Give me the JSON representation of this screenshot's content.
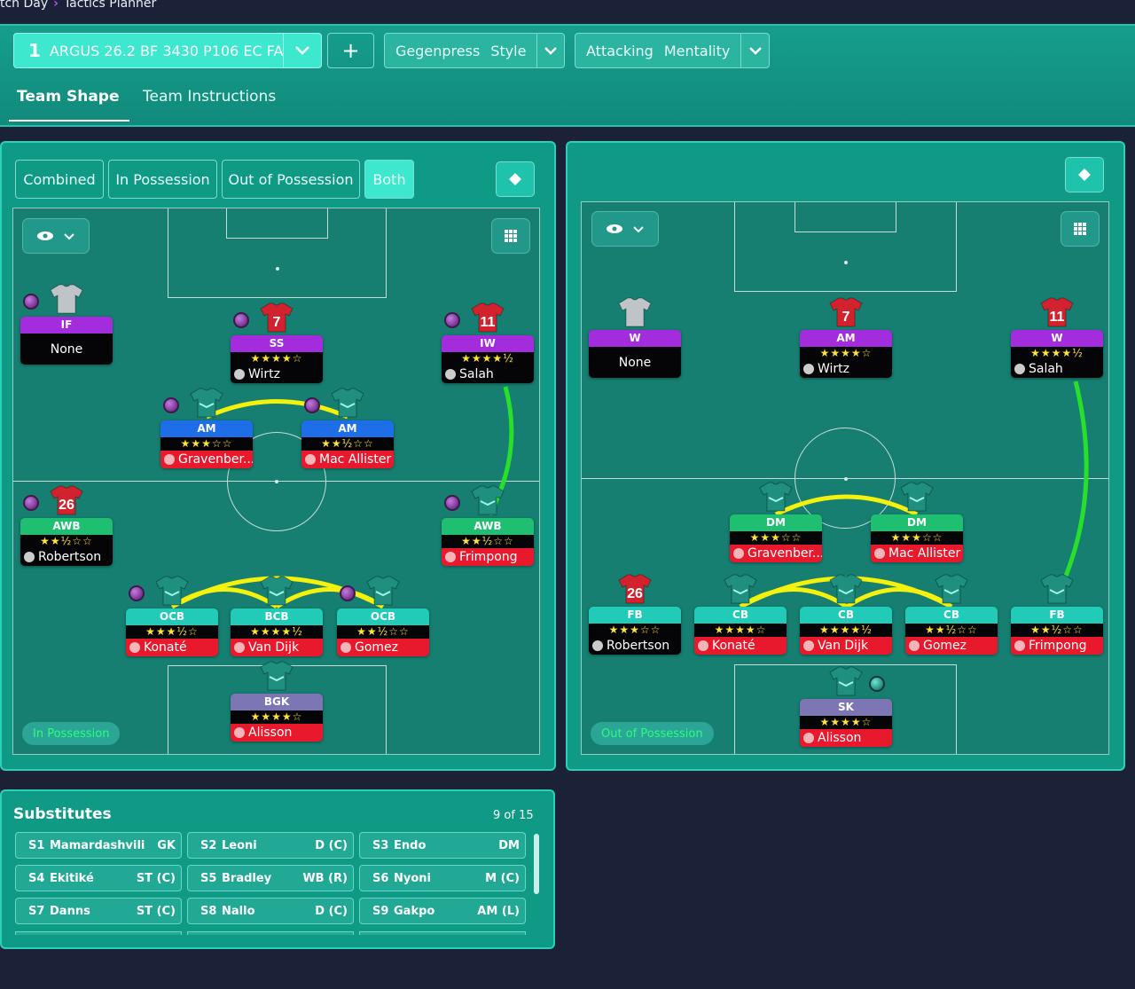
{
  "breadcrumb": {
    "parent": "tch Day",
    "current": "Tactics Planner"
  },
  "tactic": {
    "number": "1",
    "name": "ARGUS 26.2 BF 3430 P106 EC FA",
    "add_label": "+"
  },
  "style": {
    "value": "Gegenpress",
    "label": "Style"
  },
  "mentality": {
    "value": "Attacking",
    "label": "Mentality"
  },
  "tabs": {
    "team_shape": "Team Shape",
    "team_instructions": "Team Instructions"
  },
  "modes": {
    "combined": "Combined",
    "in_possession": "In Possession",
    "out_of_possession": "Out of Possession",
    "both": "Both"
  },
  "colors": {
    "accent": "#3de8cf",
    "panel": "#0f9a86",
    "pitch": "#167f71",
    "attack_role": "#a32cdc",
    "mid_role": "#1e6ee8",
    "wing_role": "#1fbf72",
    "def_role": "#22cbb8",
    "gk_role": "#7c76b4",
    "red": "#e8192c"
  },
  "left_pitch": {
    "label": "In Possession",
    "players": [
      {
        "role": "IF",
        "stars": "",
        "name": "None",
        "number": ""
      },
      {
        "role": "SS",
        "stars": "★★★★☆",
        "name": "Wirtz",
        "number": "7"
      },
      {
        "role": "IW",
        "stars": "★★★★½",
        "name": "Salah",
        "number": "11"
      },
      {
        "role": "AM",
        "stars": "★★★☆☆",
        "name": "Gravenber...",
        "number": ""
      },
      {
        "role": "AM",
        "stars": "★★½☆☆",
        "name": "Mac Allister",
        "number": ""
      },
      {
        "role": "AWB",
        "stars": "★★½☆☆",
        "name": "Robertson",
        "number": "26"
      },
      {
        "role": "AWB",
        "stars": "★★½☆☆",
        "name": "Frimpong",
        "number": ""
      },
      {
        "role": "OCB",
        "stars": "★★★½☆",
        "name": "Konaté",
        "number": ""
      },
      {
        "role": "BCB",
        "stars": "★★★★½",
        "name": "Van Dijk",
        "number": ""
      },
      {
        "role": "OCB",
        "stars": "★★½☆☆",
        "name": "Gomez",
        "number": ""
      },
      {
        "role": "BGK",
        "stars": "★★★★☆",
        "name": "Alisson",
        "number": ""
      }
    ]
  },
  "right_pitch": {
    "label": "Out of Possession",
    "players": [
      {
        "role": "W",
        "stars": "",
        "name": "None",
        "number": ""
      },
      {
        "role": "AM",
        "stars": "★★★★☆",
        "name": "Wirtz",
        "number": "7"
      },
      {
        "role": "W",
        "stars": "★★★★½",
        "name": "Salah",
        "number": "11"
      },
      {
        "role": "DM",
        "stars": "★★★☆☆",
        "name": "Gravenber...",
        "number": ""
      },
      {
        "role": "DM",
        "stars": "★★★☆☆",
        "name": "Mac Allister",
        "number": ""
      },
      {
        "role": "FB",
        "stars": "★★★☆☆",
        "name": "Robertson",
        "number": "26"
      },
      {
        "role": "CB",
        "stars": "★★★★☆",
        "name": "Konaté",
        "number": ""
      },
      {
        "role": "CB",
        "stars": "★★★★½",
        "name": "Van Dijk",
        "number": ""
      },
      {
        "role": "CB",
        "stars": "★★½☆☆",
        "name": "Gomez",
        "number": ""
      },
      {
        "role": "FB",
        "stars": "★★½☆☆",
        "name": "Frimpong",
        "number": ""
      },
      {
        "role": "SK",
        "stars": "★★★★☆",
        "name": "Alisson",
        "number": ""
      }
    ]
  },
  "substitutes": {
    "title": "Substitutes",
    "count": "9 of 15",
    "items": [
      {
        "slot": "S1",
        "name": "Mamardashvili",
        "pos": "GK"
      },
      {
        "slot": "S2",
        "name": "Leoni",
        "pos": "D (C)"
      },
      {
        "slot": "S3",
        "name": "Endo",
        "pos": "DM"
      },
      {
        "slot": "S4",
        "name": "Ekitiké",
        "pos": "ST (C)"
      },
      {
        "slot": "S5",
        "name": "Bradley",
        "pos": "WB (R)"
      },
      {
        "slot": "S6",
        "name": "Nyoni",
        "pos": "M (C)"
      },
      {
        "slot": "S7",
        "name": "Danns",
        "pos": "ST (C)"
      },
      {
        "slot": "S8",
        "name": "Nallo",
        "pos": "D (C)"
      },
      {
        "slot": "S9",
        "name": "Gakpo",
        "pos": "AM (L)"
      }
    ]
  }
}
